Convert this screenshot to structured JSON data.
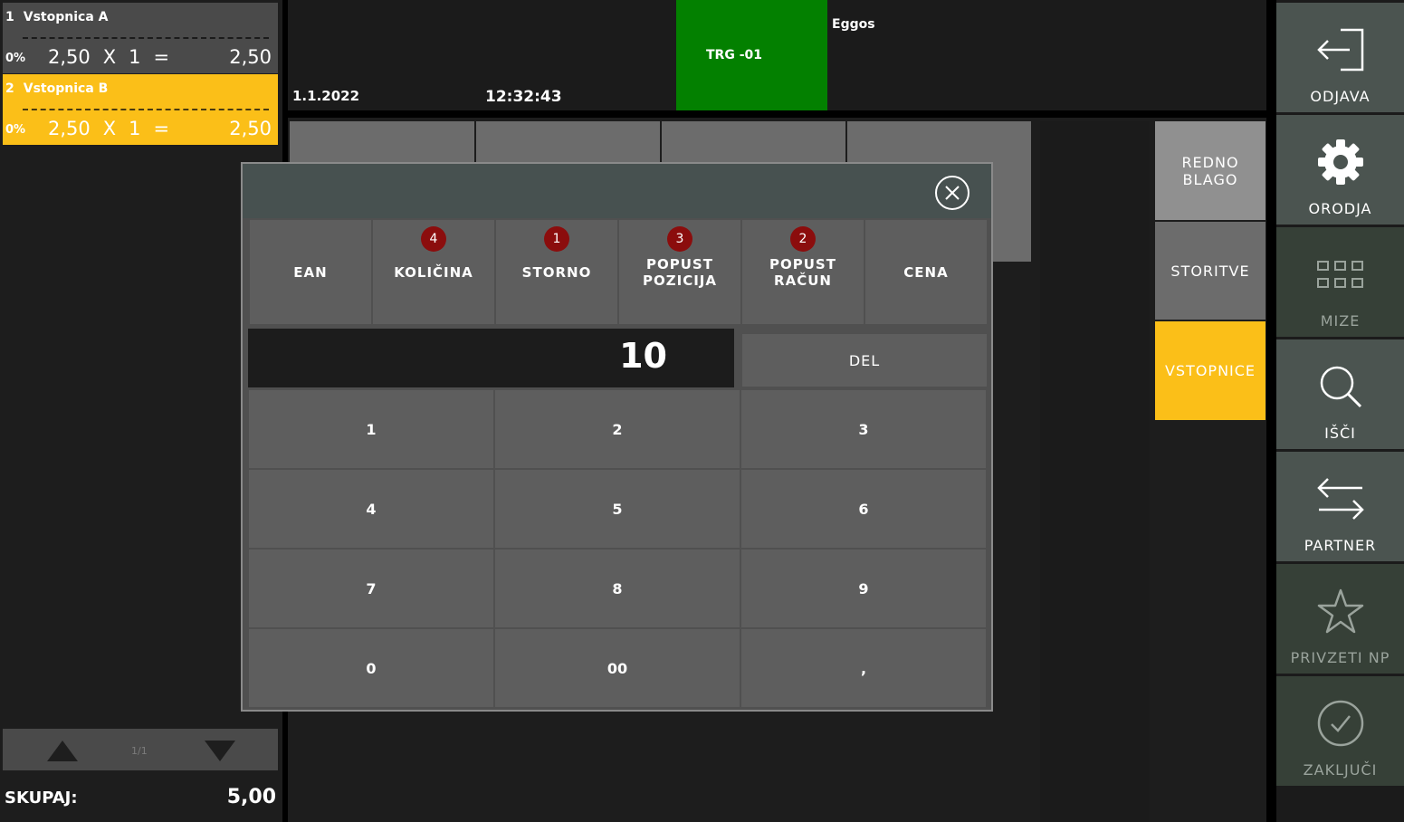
{
  "receipt": {
    "items": [
      {
        "index": "1",
        "name": "Vstopnica A",
        "tax": "0%",
        "price": "2,50",
        "times": "X",
        "qty": "1",
        "eq": "=",
        "total": "2,50"
      },
      {
        "index": "2",
        "name": "Vstopnica B",
        "tax": "0%",
        "price": "2,50",
        "times": "X",
        "qty": "1",
        "eq": "=",
        "total": "2,50"
      }
    ],
    "page": "1/1",
    "total_label": "SKUPAJ:",
    "total_value": "5,00"
  },
  "header": {
    "date": "1.1.2022",
    "time": "12:32:43",
    "terminal": "TRG -01",
    "company": "Eggos"
  },
  "categories": [
    {
      "label": "REDNO BLAGO"
    },
    {
      "label": "STORITVE"
    },
    {
      "label": "VSTOPNICE"
    }
  ],
  "nav": [
    {
      "label": "ODJAVA",
      "icon": "logout-icon"
    },
    {
      "label": "ORODJA",
      "icon": "gear-icon"
    },
    {
      "label": "MIZE",
      "icon": "tables-grid-icon"
    },
    {
      "label": "IŠČI",
      "icon": "search-icon"
    },
    {
      "label": "PARTNER",
      "icon": "swap-arrows-icon"
    },
    {
      "label": "PRIVZETI NP",
      "icon": "star-icon"
    },
    {
      "label": "ZAKLJUČI",
      "icon": "check-circle-icon"
    }
  ],
  "modal": {
    "functions": [
      {
        "label": "EAN",
        "badge": ""
      },
      {
        "label": "KOLIČINA",
        "badge": "4"
      },
      {
        "label": "STORNO",
        "badge": "1"
      },
      {
        "label": "POPUST POZICIJA",
        "badge": "3"
      },
      {
        "label": "POPUST RAČUN",
        "badge": "2"
      },
      {
        "label": "CENA",
        "badge": ""
      }
    ],
    "display_value": "10",
    "del_label": "DEL",
    "keys": [
      "1",
      "2",
      "3",
      "4",
      "5",
      "6",
      "7",
      "8",
      "9",
      "0",
      "00",
      ","
    ]
  },
  "colors": {
    "selected": "#fbbf18",
    "terminal": "#038000",
    "badge": "#8b0d0d"
  }
}
